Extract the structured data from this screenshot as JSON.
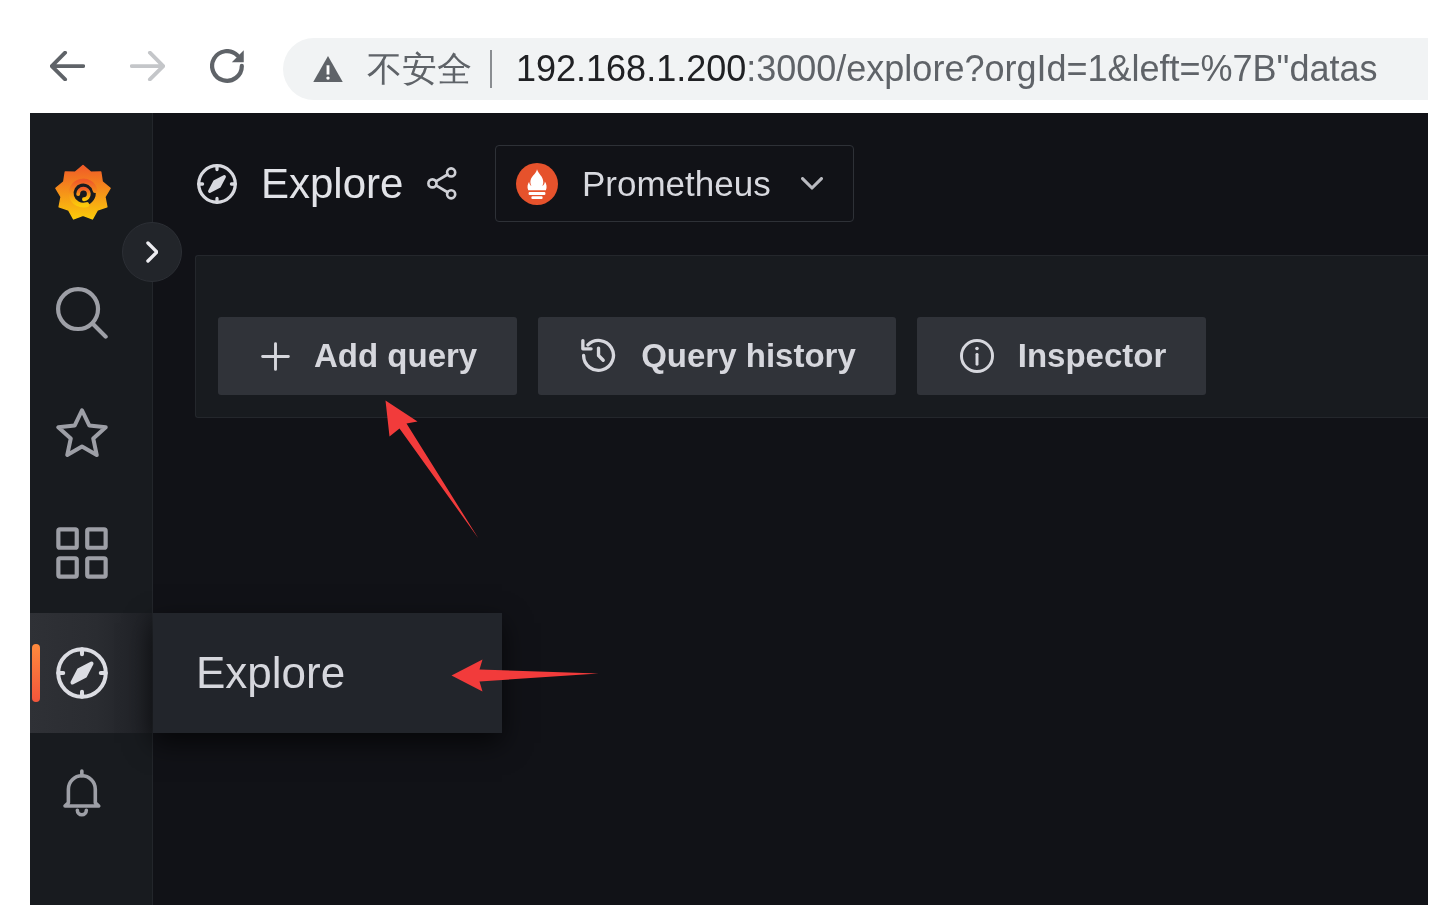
{
  "browser": {
    "nav_buttons": [
      {
        "kind": "back",
        "disabled": false
      },
      {
        "kind": "forward",
        "disabled": true
      },
      {
        "kind": "reload",
        "disabled": false
      }
    ],
    "address_bar": {
      "security_label": "不安全",
      "url_host": "192.168.1.200",
      "url_rest": ":3000/explore?orgId=1&left=%7B\"datas"
    }
  },
  "sidebar": {
    "items": [
      {
        "kind": "search",
        "selected": false
      },
      {
        "kind": "starred",
        "selected": false
      },
      {
        "kind": "dashboards",
        "selected": false
      },
      {
        "kind": "explore",
        "selected": true,
        "flyout": "Explore"
      },
      {
        "kind": "alerting",
        "selected": false
      }
    ]
  },
  "header": {
    "title": "Explore",
    "datasource": "Prometheus"
  },
  "query_toolbar": [
    {
      "kind": "add",
      "label": "Add query"
    },
    {
      "kind": "history",
      "label": "Query history"
    },
    {
      "kind": "inspector",
      "label": "Inspector"
    }
  ],
  "annotations": [
    {
      "kind": "arrow"
    },
    {
      "kind": "arrow"
    }
  ]
}
